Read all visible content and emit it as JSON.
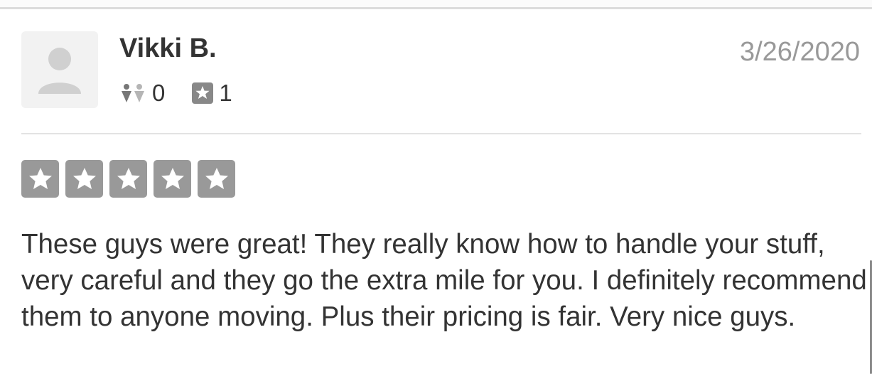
{
  "review": {
    "author": {
      "name": "Vikki B.",
      "friends_count": "0",
      "reviews_count": "1",
      "avatar_icon": "default-user-avatar-icon"
    },
    "date": "3/26/2020",
    "rating": {
      "stars": 5,
      "max_stars": 5,
      "star_color": "#999999"
    },
    "text": "These guys were great! They really know how to handle your stuff, very careful and they go the extra mile for you. I definitely recommend them to anyone moving. Plus their pricing is fair. Very nice guys."
  },
  "icons": {
    "friends": "friends-icon",
    "reviews": "review-star-icon",
    "rating_star": "star-icon"
  },
  "colors": {
    "text_primary": "#333333",
    "text_muted": "#999999",
    "divider": "#e3e3e3",
    "avatar_bg": "#f2f2f2"
  }
}
